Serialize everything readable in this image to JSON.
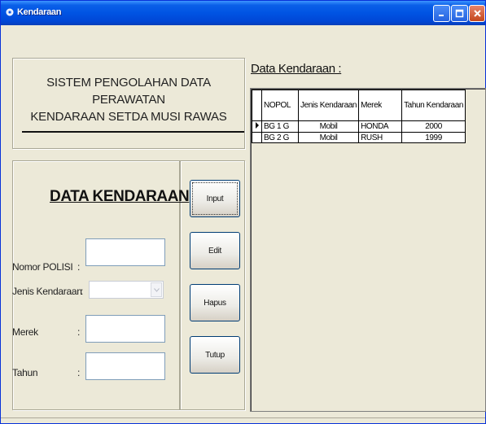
{
  "window": {
    "title": "Kendaraan",
    "title_color": "#ffffff",
    "titlebar_color": "#0054e3"
  },
  "header": {
    "line1": "SISTEM PENGOLAHAN DATA PERAWATAN",
    "line2": "KENDARAAN SETDA MUSI RAWAS"
  },
  "form": {
    "title": "DATA KENDARAAN",
    "fields": {
      "nopol": {
        "label": "Nomor POLISI",
        "value": ""
      },
      "jenis": {
        "label": "Jenis Kendaraan",
        "value": ""
      },
      "merek": {
        "label": "Merek",
        "value": ""
      },
      "tahun": {
        "label": "Tahun",
        "value": ""
      }
    }
  },
  "buttons": {
    "input": "Input",
    "edit": "Edit",
    "hapus": "Hapus",
    "tutup": "Tutup"
  },
  "grid": {
    "caption": "Data Kendaraan :",
    "columns": [
      "NOPOL",
      "Jenis Kendaraan",
      "Merek",
      "Tahun Kendaraan"
    ],
    "rows": [
      [
        "BG 1 G",
        "Mobil",
        "HONDA",
        "2000"
      ],
      [
        "BG 2 G",
        "Mobil",
        "RUSH",
        "1999"
      ]
    ],
    "selected_row": 0
  }
}
